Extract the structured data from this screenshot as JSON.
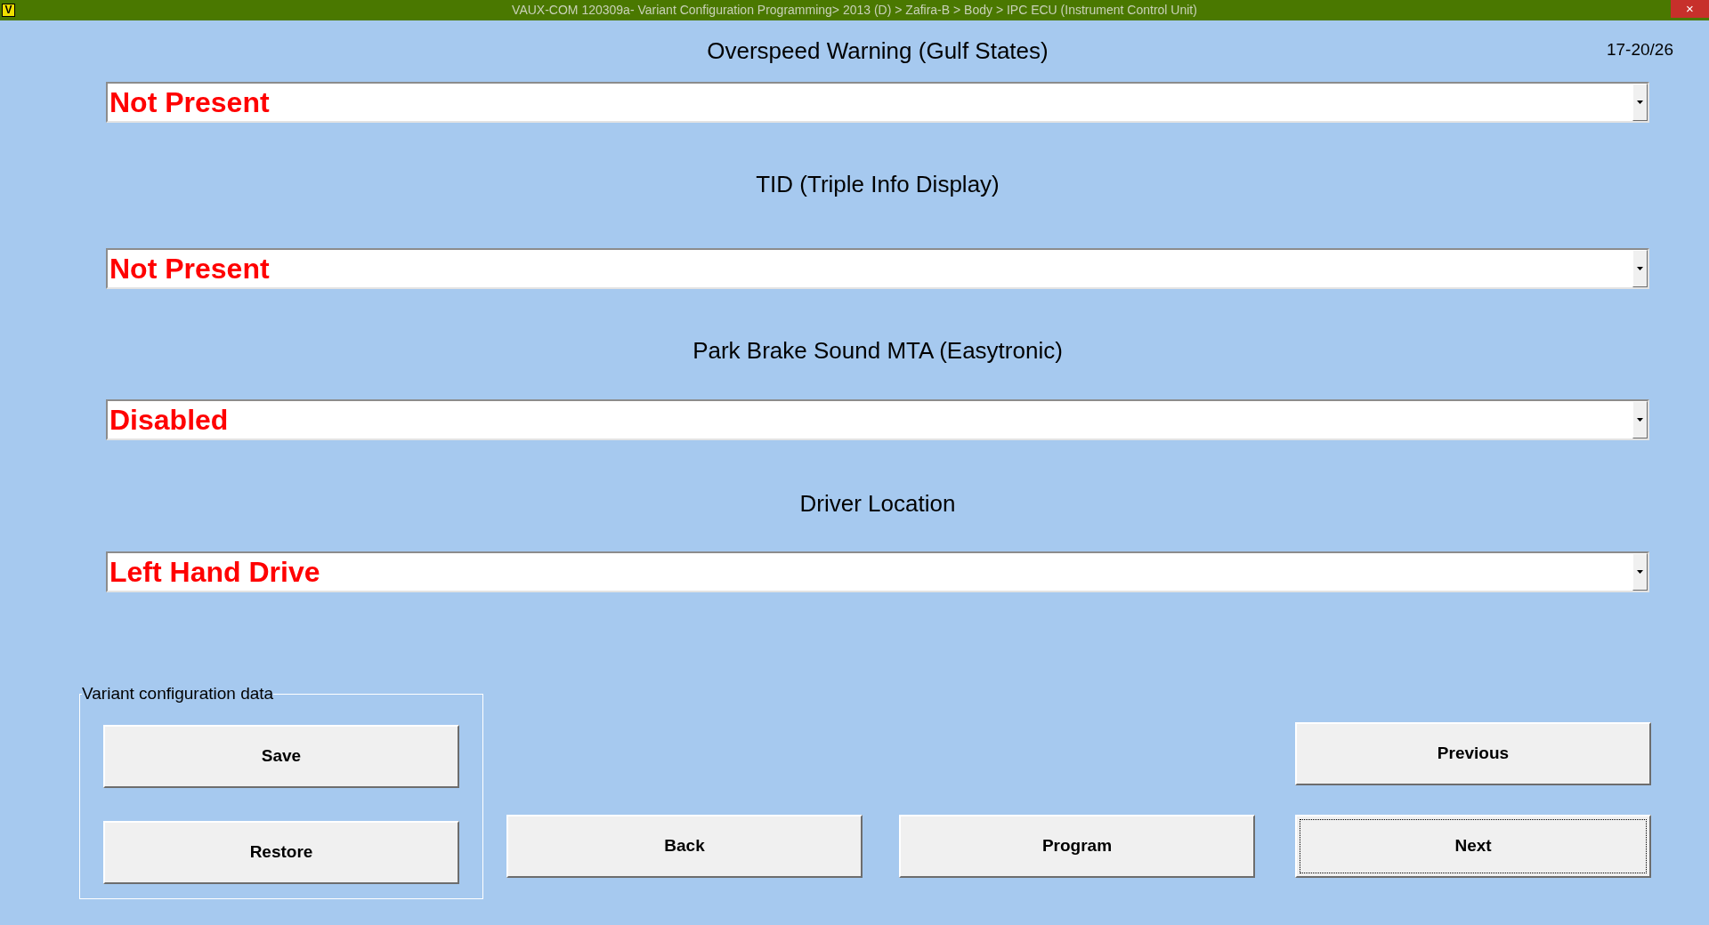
{
  "title_bar": {
    "logo": "V",
    "title": "VAUX-COM 120309a- Variant Configuration Programming> 2013 (D) > Zafira-B > Body > IPC ECU (Instrument Control Unit)",
    "close": "×"
  },
  "page_counter": "17-20/26",
  "fields": [
    {
      "label": "Overspeed Warning (Gulf States)",
      "value": "Not Present"
    },
    {
      "label": "TID (Triple Info Display)",
      "value": "Not Present"
    },
    {
      "label": "Park Brake Sound MTA (Easytronic)",
      "value": "Disabled"
    },
    {
      "label": "Driver Location",
      "value": "Left Hand Drive"
    }
  ],
  "variant_group": {
    "legend": "Variant configuration data",
    "buttons": [
      {
        "label": "Save",
        "focused": false
      },
      {
        "label": "Restore",
        "focused": false
      }
    ]
  },
  "nav_buttons": [
    {
      "label": "Back",
      "focused": false
    },
    {
      "label": "Program",
      "focused": false
    },
    {
      "label": "Previous",
      "focused": false
    },
    {
      "label": "Next",
      "focused": true
    }
  ]
}
